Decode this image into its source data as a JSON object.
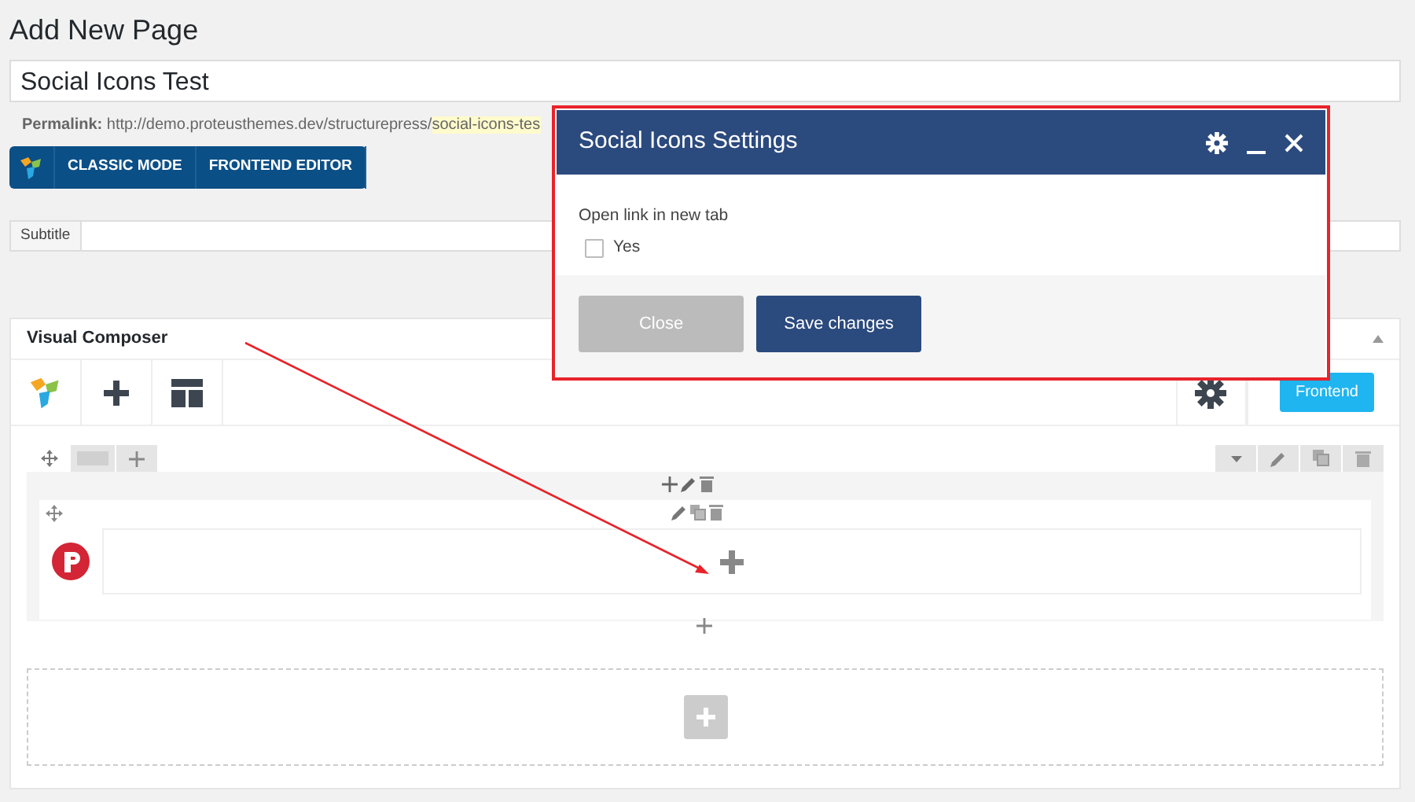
{
  "page_title": "Add New Page",
  "title_field": {
    "value": "Social Icons Test"
  },
  "permalink": {
    "label": "Permalink:",
    "url": "http://demo.proteusthemes.dev/structurepress/",
    "slug": "social-icons-tes"
  },
  "editor_buttons": [
    "CLASSIC MODE",
    "FRONTEND EDITOR"
  ],
  "subtitle": {
    "label": "Subtitle"
  },
  "composer": {
    "title": "Visual Composer",
    "frontend_button": "Frontend"
  },
  "modal": {
    "title": "Social Icons Settings",
    "field_label": "Open link in new tab",
    "option": {
      "label": "Yes",
      "checked": false
    },
    "buttons": [
      {
        "label": "Close",
        "kind": "secondary"
      },
      {
        "label": "Save changes",
        "kind": "primary"
      }
    ]
  }
}
